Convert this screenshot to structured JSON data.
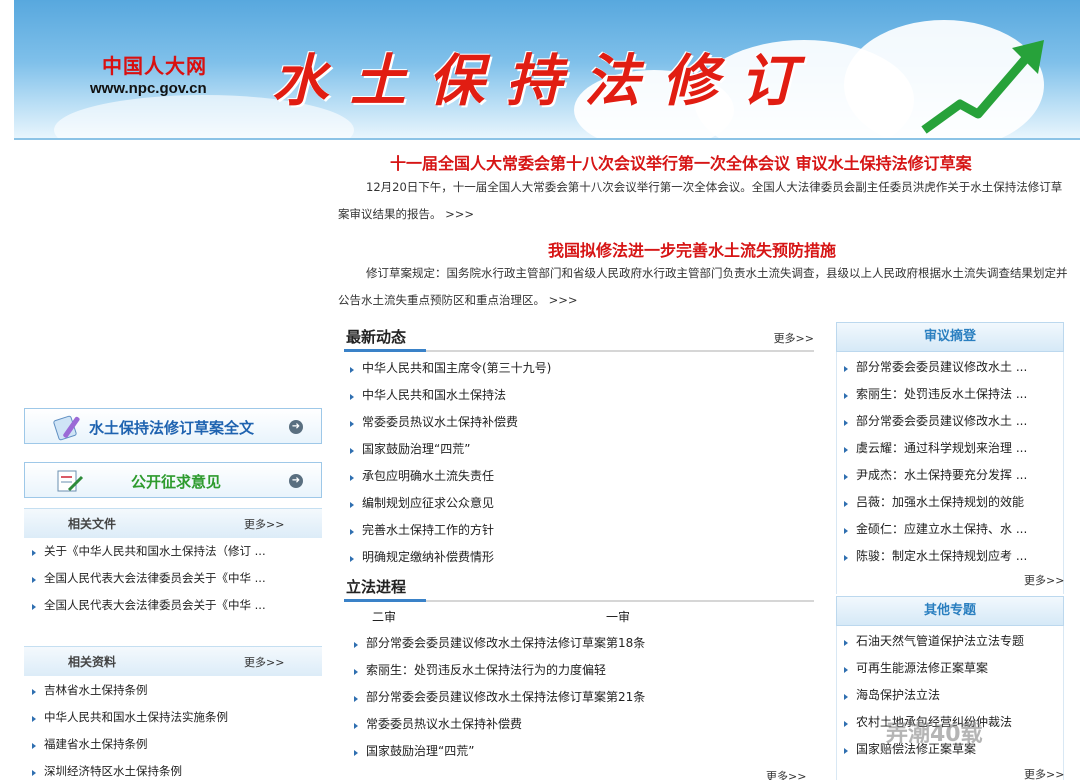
{
  "banner": {
    "logo_name": "中国人大网",
    "logo_url": "www.npc.gov.cn",
    "title": "水土保持法修订"
  },
  "headlines": [
    {
      "title": "十一届全国人大常委会第十八次会议举行第一次全体会议 审议水土保持法修订草案",
      "summary": "12月20日下午，十一届全国人大常委会第十八次会议举行第一次全体会议。全国人大法律委员会副主任委员洪虎作关于水土保持法修订草案审议结果的报告。",
      "more": ">>>"
    },
    {
      "title": "我国拟修法进一步完善水土流失预防措施",
      "summary": "修订草案规定：国务院水行政主管部门和省级人民政府水行政主管部门负责水土流失调查，县级以上人民政府根据水土流失调查结果划定并公告水土流失重点预防区和重点治理区。",
      "more": ">>>"
    }
  ],
  "latest": {
    "title": "最新动态",
    "more": "更多>>",
    "items": [
      "中华人民共和国主席令(第三十九号)",
      "中华人民共和国水土保持法",
      "常委委员热议水土保持补偿费",
      "国家鼓励治理“四荒”",
      "承包应明确水土流失责任",
      "编制规划应征求公众意见",
      "完善水土保持工作的方针",
      "明确规定缴纳补偿费情形"
    ]
  },
  "legislation": {
    "title": "立法进程",
    "more": "更多>>",
    "tabs": [
      "二审",
      "一审"
    ],
    "items": [
      "部分常委会委员建议修改水土保持法修订草案第18条",
      "索丽生：处罚违反水土保持法行为的力度偏轻",
      "部分常委会委员建议修改水土保持法修订草案第21条",
      "常委委员热议水土保持补偿费",
      "国家鼓励治理“四荒”"
    ]
  },
  "review": {
    "title": "审议摘登",
    "more": "更多>>",
    "items": [
      "部分常委会委员建议修改水土 ...",
      "索丽生：处罚违反水土保持法 ...",
      "部分常委会委员建议修改水土 ...",
      "虞云耀：通过科学规划来治理 ...",
      "尹成杰：水土保持要充分发挥 ...",
      "吕薇：加强水土保持规划的效能",
      "金硕仁：应建立水土保持、水 ...",
      "陈骏：制定水土保持规划应考 ..."
    ]
  },
  "topics": {
    "title": "其他专题",
    "more": "更多>>",
    "items": [
      "石油天然气管道保护法立法专题",
      "可再生能源法修正案草案",
      "海岛保护法立法",
      "农村土地承包经营纠纷仲裁法",
      "国家赔偿法修正案草案"
    ]
  },
  "left": {
    "full_text_button": "水土保持法修订草案全文",
    "solicit_button": "公开征求意见",
    "related_docs": {
      "title": "相关文件",
      "more": "更多>>",
      "items": [
        "关于《中华人民共和国水土保持法（修订 ...",
        "全国人民代表大会法律委员会关于《中华 ...",
        "全国人民代表大会法律委员会关于《中华 ..."
      ]
    },
    "related_materials": {
      "title": "相关资料",
      "more": "更多>>",
      "items": [
        "吉林省水土保持条例",
        "中华人民共和国水土保持法实施条例",
        "福建省水土保持条例",
        "深圳经济特区水土保持条例"
      ]
    }
  },
  "watermark": "弄潮40载"
}
